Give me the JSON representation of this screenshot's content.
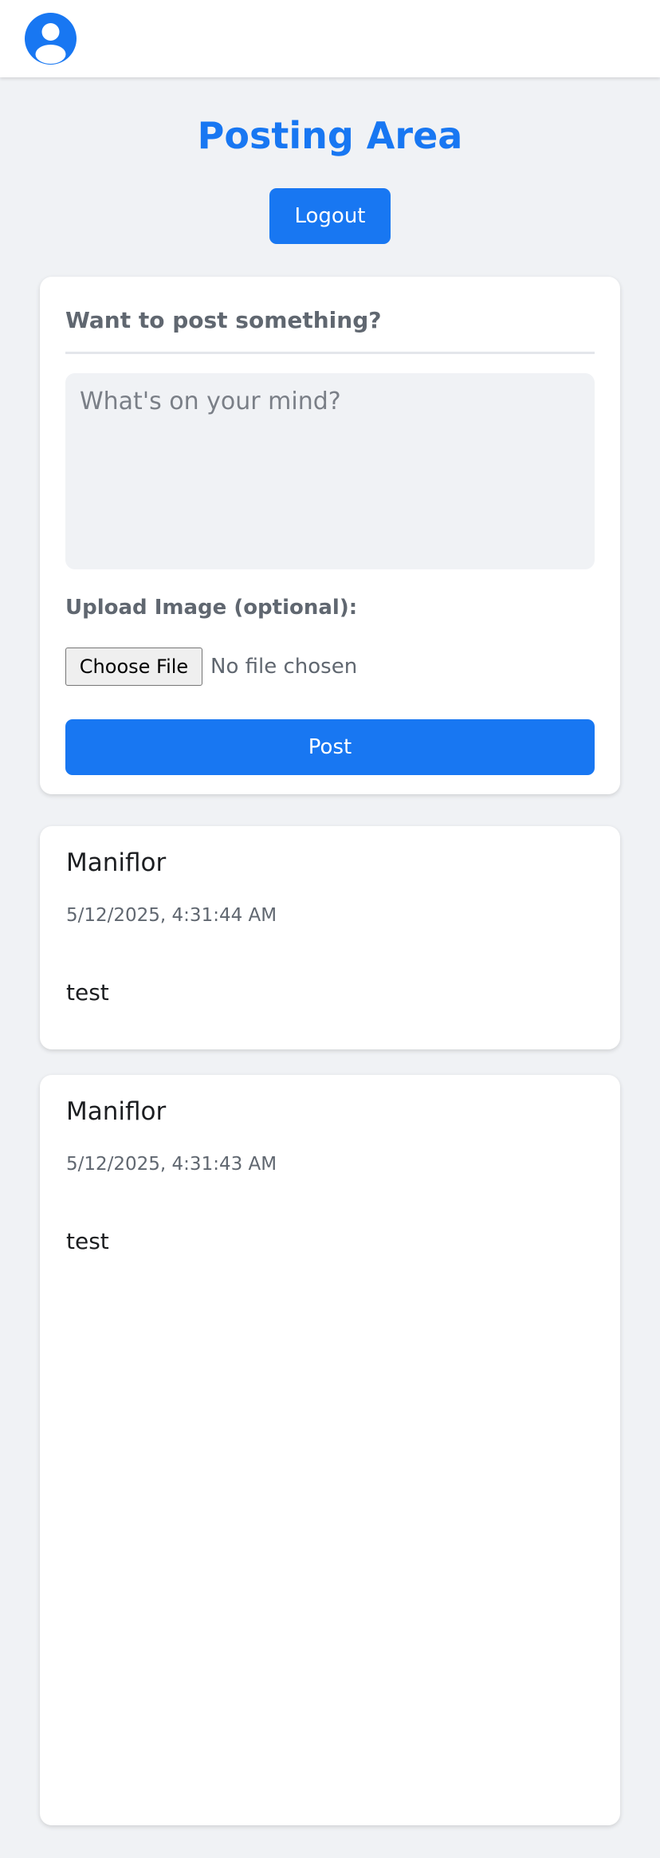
{
  "header": {
    "profile_icon": "user-profile-icon"
  },
  "page": {
    "title": "Posting Area",
    "logout_label": "Logout"
  },
  "composer": {
    "heading": "Want to post something?",
    "textarea_value": "",
    "textarea_placeholder": "What's on your mind?",
    "upload_label": "Upload Image (optional):",
    "choose_file_label": "Choose File",
    "file_status": "No file chosen",
    "post_label": "Post"
  },
  "posts": [
    {
      "author": "Maniflor",
      "timestamp": "5/12/2025, 4:31:44 AM",
      "content": "test"
    },
    {
      "author": "Maniflor",
      "timestamp": "5/12/2025, 4:31:43 AM",
      "content": "test"
    }
  ],
  "colors": {
    "accent": "#1877f2",
    "background": "#f0f2f5",
    "card": "#ffffff",
    "muted_text": "#606770"
  }
}
